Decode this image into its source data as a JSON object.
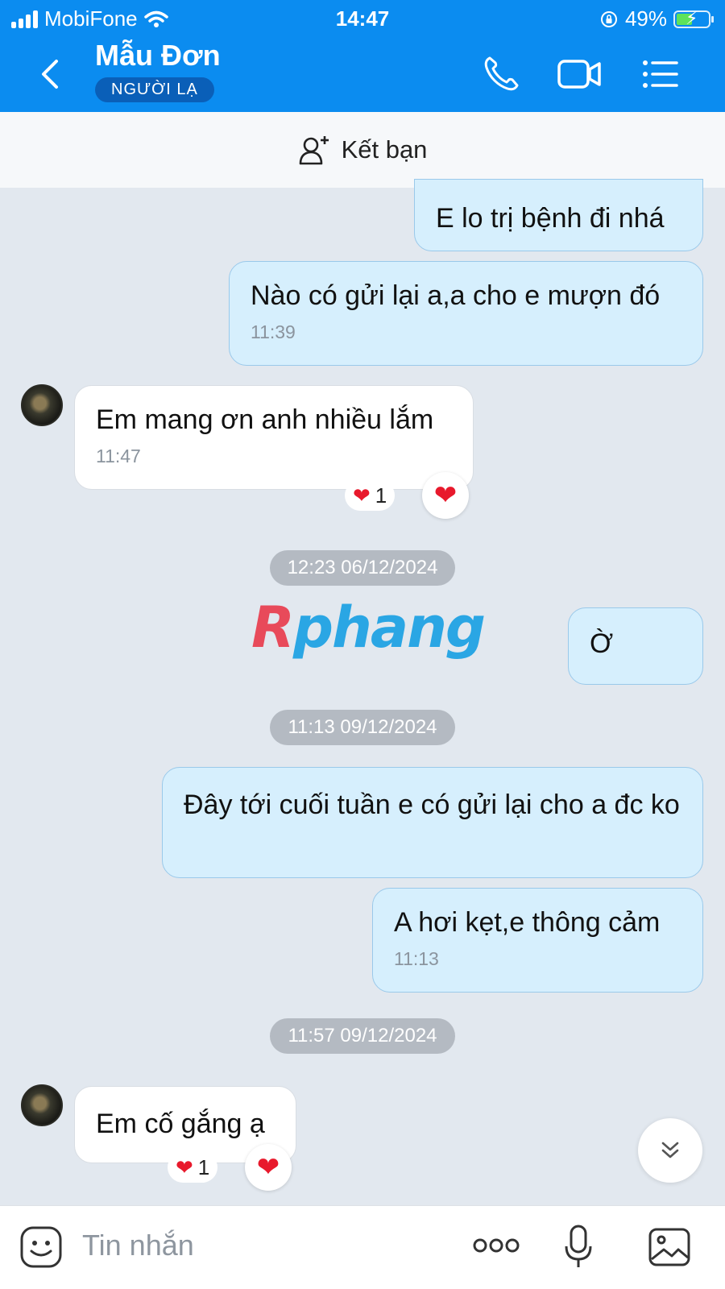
{
  "status_bar": {
    "carrier": "MobiFone",
    "time": "14:47",
    "battery": "49%",
    "battery_level": 0.49
  },
  "header": {
    "contact_name": "Mẫu Đơn",
    "badge": "NGƯỜI LẠ",
    "icons": [
      "back-chevron-icon",
      "phone-icon",
      "video-call-icon",
      "menu-icon"
    ]
  },
  "friend_bar": {
    "label": "Kết bạn"
  },
  "messages": [
    {
      "dir": "out",
      "text": "E lo trị bệnh đi nhá"
    },
    {
      "dir": "out",
      "text": "Nào có gửi lại a,a cho e mượn đó",
      "time": "11:39"
    },
    {
      "dir": "in",
      "text": "Em mang ơn anh nhiều lắm",
      "time": "11:47",
      "reaction_count": "1"
    },
    {
      "dir": "out",
      "text": "Ờ"
    },
    {
      "dir": "out",
      "text": "Đây tới cuối tuần e có gửi lại cho a đc ko"
    },
    {
      "dir": "out",
      "text": "A hơi kẹt,e thông cảm",
      "time": "11:13"
    },
    {
      "dir": "in",
      "text": "Em cố gắng ạ",
      "reaction_count": "1"
    }
  ],
  "date_separators": [
    "12:23 06/12/2024",
    "11:13 09/12/2024",
    "11:57 09/12/2024"
  ],
  "watermark": {
    "first": "R",
    "rest": "phang"
  },
  "input_bar": {
    "placeholder": "Tin nhắn"
  },
  "colors": {
    "header": "#0b8cf0",
    "bubble_out": "#d6effd",
    "bubble_in": "#ffffff",
    "background": "#e2e8ef",
    "heart": "#e8192c"
  }
}
